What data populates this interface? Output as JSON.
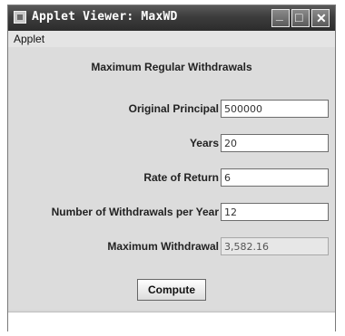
{
  "window": {
    "title": "Applet Viewer: MaxWD"
  },
  "menu": {
    "items": [
      "Applet"
    ]
  },
  "main": {
    "heading": "Maximum Regular Withdrawals",
    "fields": [
      {
        "label": "Original Principal",
        "value": "500000",
        "editable": true
      },
      {
        "label": "Years",
        "value": "20",
        "editable": true
      },
      {
        "label": "Rate of Return",
        "value": "6",
        "editable": true
      },
      {
        "label": "Number of Withdrawals per Year",
        "value": "12",
        "editable": true
      },
      {
        "label": "Maximum Withdrawal",
        "value": "3,582.16",
        "editable": false
      }
    ],
    "compute_label": "Compute"
  },
  "icons": [
    "app-icon",
    "minimize-icon",
    "maximize-icon",
    "close-icon"
  ]
}
